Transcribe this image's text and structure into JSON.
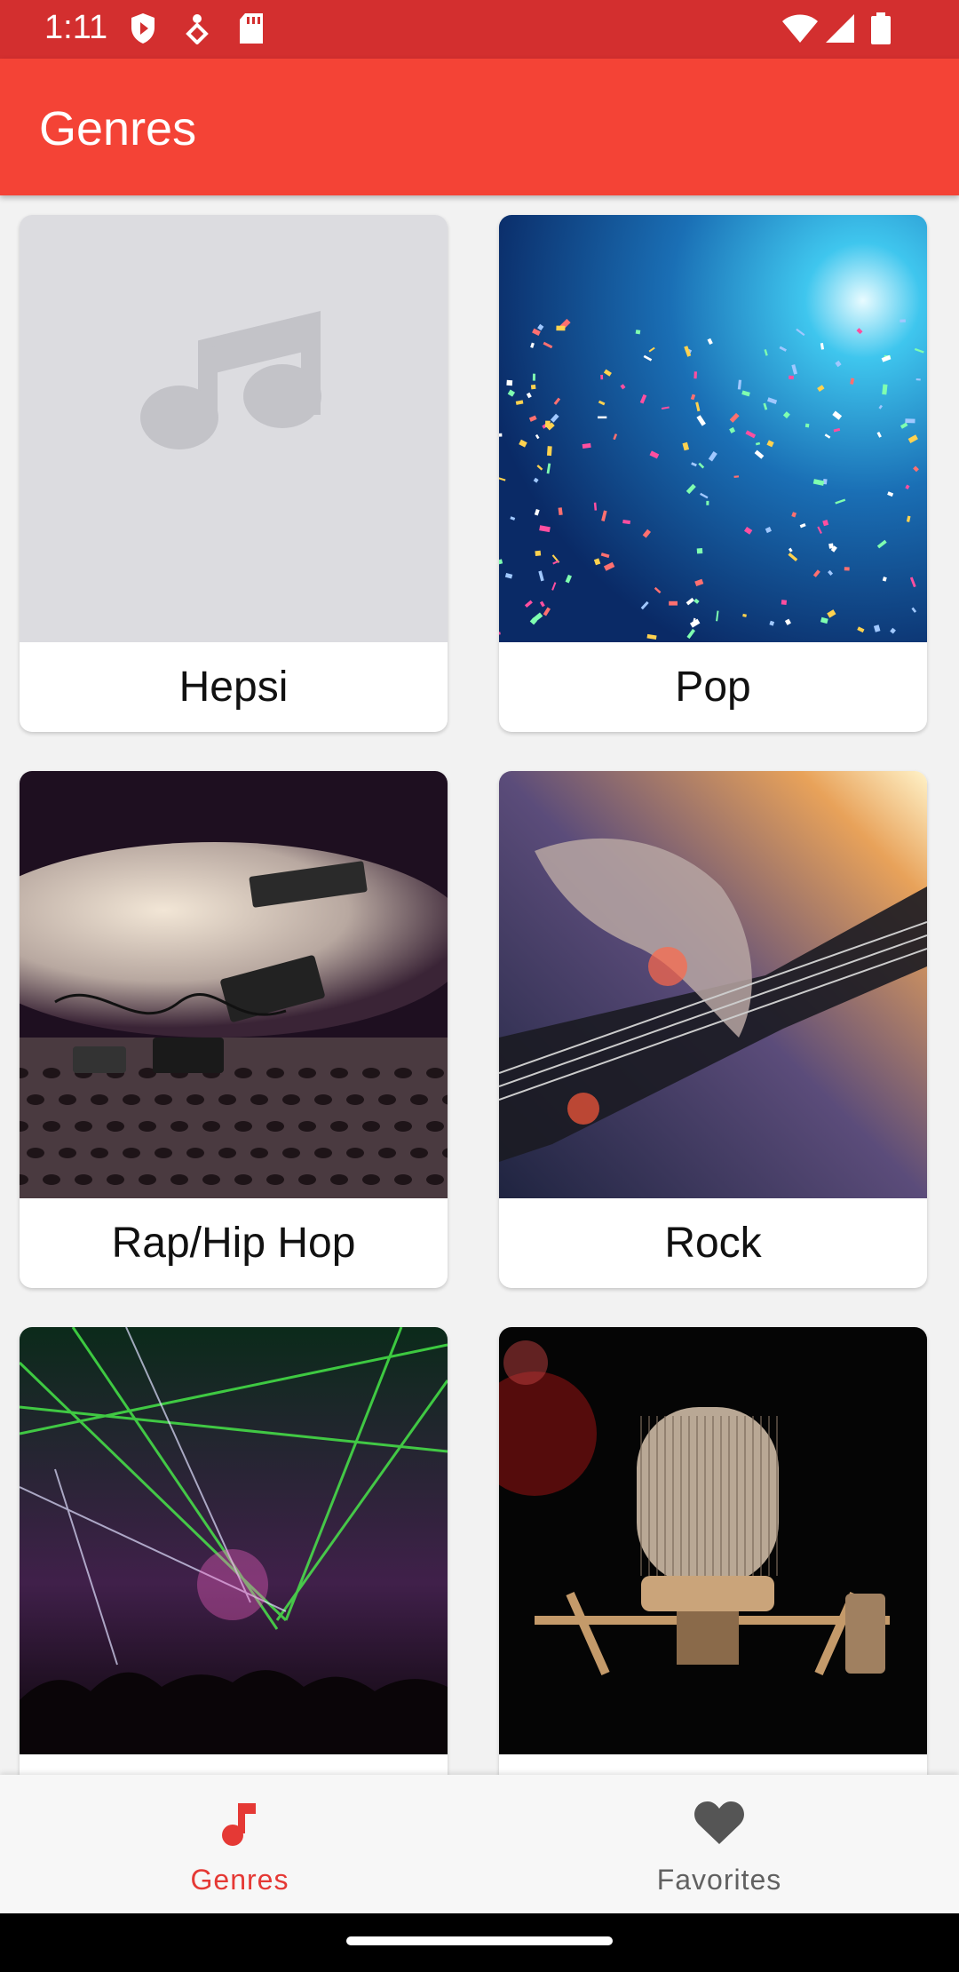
{
  "status_bar": {
    "time": "1:11",
    "icons": [
      "shield-play-icon",
      "location-person-icon",
      "sd-card-icon",
      "wifi-icon",
      "signal-icon",
      "battery-icon"
    ]
  },
  "app_bar": {
    "title": "Genres"
  },
  "genres": [
    {
      "label": "Hepsi",
      "image": "music-note-placeholder"
    },
    {
      "label": "Pop",
      "image": "confetti-concert-photo"
    },
    {
      "label": "Rap/Hip Hop",
      "image": "dj-equipment-photo"
    },
    {
      "label": "Rock",
      "image": "electric-guitar-photo"
    },
    {
      "label": "",
      "image": "laser-concert-photo"
    },
    {
      "label": "",
      "image": "studio-microphone-photo"
    }
  ],
  "bottom_nav": {
    "items": [
      {
        "label": "Genres",
        "icon": "music-note-icon",
        "active": true
      },
      {
        "label": "Favorites",
        "icon": "heart-icon",
        "active": false
      }
    ],
    "active_color": "#e53935",
    "inactive_color": "#616161"
  },
  "colors": {
    "status_bar": "#d32f2f",
    "app_bar": "#f44336",
    "background": "#f2f2f2"
  }
}
